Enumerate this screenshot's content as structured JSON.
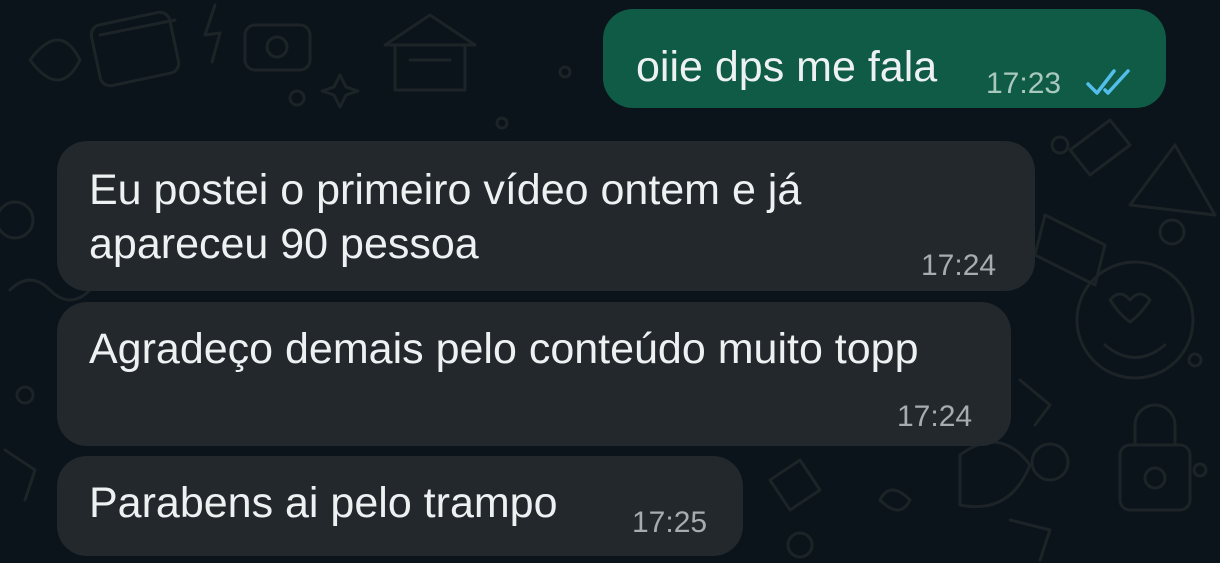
{
  "colors": {
    "background": "#0b141a",
    "outgoing_bubble": "#0f5b45",
    "incoming_bubble": "#22282c",
    "read_ticks": "#53bdeb"
  },
  "messages": [
    {
      "direction": "outgoing",
      "text": "oiie dps me fala",
      "time": "17:23",
      "status_icon": "double-check-read-icon"
    },
    {
      "direction": "incoming",
      "text": "Eu postei o primeiro vídeo ontem e já\napareceu 90 pessoa",
      "time": "17:24"
    },
    {
      "direction": "incoming",
      "text": "Agradeço demais pelo conteúdo muito topp",
      "time": "17:24"
    },
    {
      "direction": "incoming",
      "text": "Parabens ai pelo trampo",
      "time": "17:25"
    }
  ]
}
